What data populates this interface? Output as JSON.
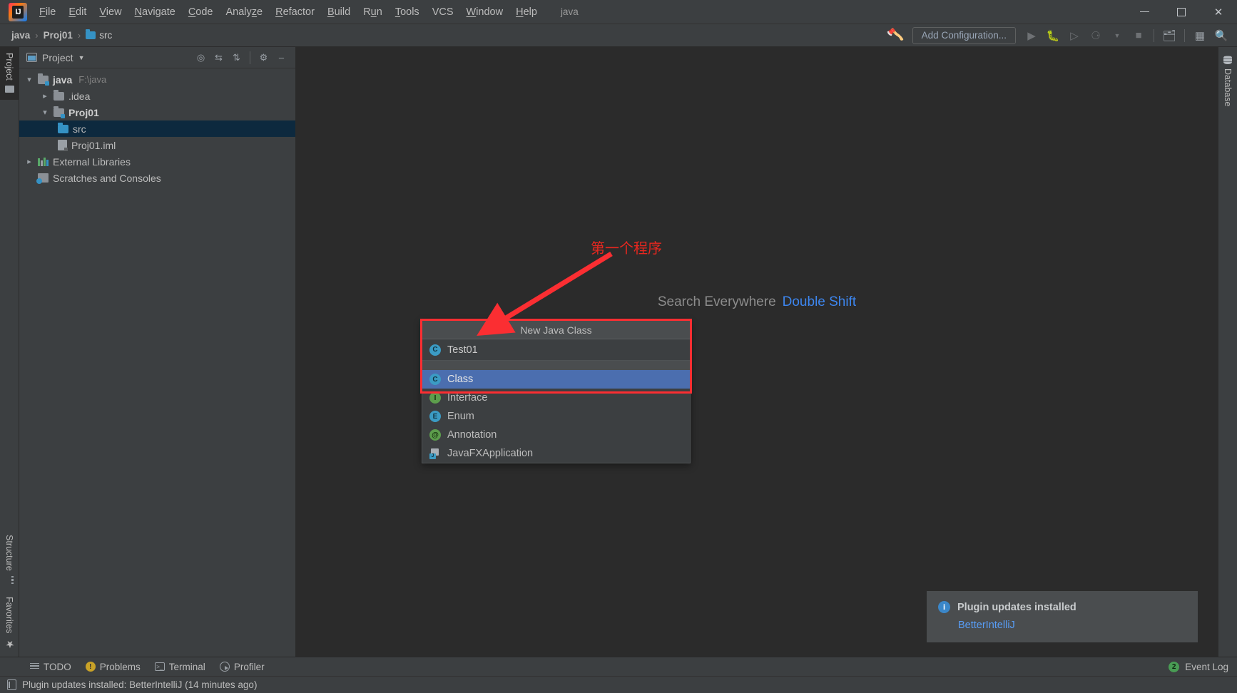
{
  "titlebar": {
    "logo_text": "IJ",
    "project_label": "java",
    "menus": [
      {
        "label": "File",
        "mnemonic": "F"
      },
      {
        "label": "Edit",
        "mnemonic": "E"
      },
      {
        "label": "View",
        "mnemonic": "V"
      },
      {
        "label": "Navigate",
        "mnemonic": "N"
      },
      {
        "label": "Code",
        "mnemonic": "C"
      },
      {
        "label": "Analyze",
        "mnemonic": "z"
      },
      {
        "label": "Refactor",
        "mnemonic": "R"
      },
      {
        "label": "Build",
        "mnemonic": "B"
      },
      {
        "label": "Run",
        "mnemonic": "u"
      },
      {
        "label": "Tools",
        "mnemonic": "T"
      },
      {
        "label": "VCS",
        "mnemonic": ""
      },
      {
        "label": "Window",
        "mnemonic": "W"
      },
      {
        "label": "Help",
        "mnemonic": "H"
      }
    ],
    "window_controls": {
      "minimize": "minimize-icon",
      "maximize": "maximize-icon",
      "close": "close-icon"
    }
  },
  "navbar": {
    "breadcrumbs": [
      "java",
      "Proj01",
      "src"
    ],
    "separator": "›",
    "hammer_icon": "build-hammer-icon",
    "add_configuration": "Add Configuration...",
    "icons": [
      "run-icon",
      "debug-icon",
      "run-coverage-icon",
      "profile-icon",
      "dropdown-icon",
      "stop-icon",
      "project-structure-icon",
      "open-tool-window-icon",
      "search-icon"
    ]
  },
  "left_strip": {
    "top_tabs": [
      {
        "label": "Project",
        "icon": "project-folder-icon",
        "active": true
      }
    ],
    "bottom_tabs": [
      {
        "label": "Structure",
        "icon": "structure-icon"
      },
      {
        "label": "Favorites",
        "icon": "star-icon"
      }
    ]
  },
  "right_strip": {
    "tabs": [
      {
        "label": "Database",
        "icon": "database-icon"
      }
    ]
  },
  "project_panel": {
    "title": "Project",
    "window_icon": "project-window-icon",
    "dropdown_icon": "chevron-down-icon",
    "tools": [
      "locate-icon",
      "expand-all-icon",
      "collapse-all-icon",
      "settings-gear-icon",
      "hide-icon"
    ],
    "tree": [
      {
        "label": "java",
        "suffix": "F:\\java",
        "icon": "source-root-folder-icon",
        "arrow": "expanded",
        "depth": 1,
        "bold": true,
        "selected": false
      },
      {
        "label": ".idea",
        "suffix": "",
        "icon": "folder-icon",
        "arrow": "collapsed",
        "depth": 2,
        "bold": false,
        "selected": false
      },
      {
        "label": "Proj01",
        "suffix": "",
        "icon": "module-folder-icon",
        "arrow": "expanded",
        "depth": 2,
        "bold": true,
        "selected": false
      },
      {
        "label": "src",
        "suffix": "",
        "icon": "source-folder-icon",
        "arrow": "none",
        "depth": 3,
        "bold": false,
        "selected": true
      },
      {
        "label": "Proj01.iml",
        "suffix": "",
        "icon": "iml-file-icon",
        "arrow": "none",
        "depth": 3,
        "bold": false,
        "selected": false
      },
      {
        "label": "External Libraries",
        "suffix": "",
        "icon": "external-libraries-icon",
        "arrow": "collapsed",
        "depth": 1,
        "bold": false,
        "selected": false
      },
      {
        "label": "Scratches and Consoles",
        "suffix": "",
        "icon": "scratches-icon",
        "arrow": "none",
        "depth": 1,
        "bold": false,
        "selected": false
      }
    ]
  },
  "editor": {
    "hint_text": "Search Everywhere",
    "hint_key": "Double Shift"
  },
  "popup": {
    "title": "New Java Class",
    "input_value": "Test01",
    "input_icon": "class-icon",
    "items": [
      {
        "label": "Class",
        "icon": "class-icon",
        "badge": "C",
        "badge_class": "c",
        "selected": true
      },
      {
        "label": "Interface",
        "icon": "interface-icon",
        "badge": "I",
        "badge_class": "i",
        "selected": false
      },
      {
        "label": "Enum",
        "icon": "enum-icon",
        "badge": "E",
        "badge_class": "e",
        "selected": false
      },
      {
        "label": "Annotation",
        "icon": "annotation-icon",
        "badge": "@",
        "badge_class": "a",
        "selected": false
      },
      {
        "label": "JavaFXApplication",
        "icon": "javafx-application-icon",
        "badge": "",
        "badge_class": "fx",
        "selected": false
      }
    ]
  },
  "annotations": {
    "note_text": "第一个程序",
    "note_color": "#e8271f",
    "box_color": "#fb2e32",
    "arrow_color": "#fb2e32"
  },
  "notification": {
    "icon": "info-icon",
    "title": "Plugin updates installed",
    "link": "BetterIntelliJ"
  },
  "tool_window_bar": {
    "items": [
      {
        "label": "TODO",
        "icon": "todo-icon"
      },
      {
        "label": "Problems",
        "icon": "problems-icon"
      },
      {
        "label": "Terminal",
        "icon": "terminal-icon"
      },
      {
        "label": "Profiler",
        "icon": "profiler-icon"
      }
    ],
    "event_log": {
      "label": "Event Log",
      "count": "2",
      "icon": "event-log-icon"
    }
  },
  "statusbar": {
    "icon": "status-message-icon",
    "message": "Plugin updates installed: BetterIntelliJ (14 minutes ago)"
  }
}
